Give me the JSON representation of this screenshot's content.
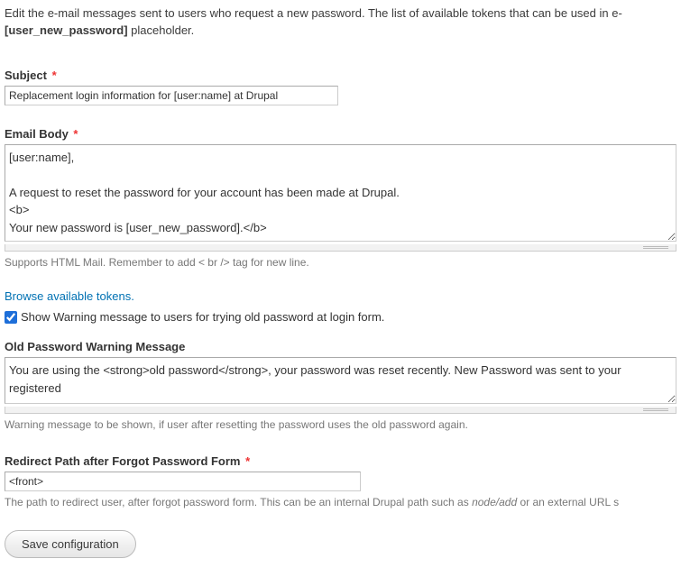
{
  "intro": {
    "line1": "Edit the e-mail messages sent to users who request a new password. The list of available tokens that can be used in e-",
    "bold_token": "[user_new_password]",
    "after_bold": " placeholder."
  },
  "subject": {
    "label": "Subject",
    "value": "Replacement login information for [user:name] at Drupal"
  },
  "email_body": {
    "label": "Email Body",
    "value": "[user:name],\n\nA request to reset the password for your account has been made at Drupal.\n<b>\nYour new password is [user_new_password].</b>",
    "description": "Supports HTML Mail. Remember to add < br /> tag for new line."
  },
  "tokens_link": "Browse available tokens.",
  "show_warning": {
    "checked": true,
    "label": "Show Warning message to users for trying old password at login form."
  },
  "old_pw_warning": {
    "label": "Old Password Warning Message",
    "value": "You are using the <strong>old password</strong>, your password was reset recently. New Password was sent to your registered",
    "description": "Warning message to be shown, if user after resetting the password uses the old password again."
  },
  "redirect": {
    "label": "Redirect Path after Forgot Password Form",
    "value": "<front>",
    "description_before": "The path to redirect user, after forgot password form. This can be an internal Drupal path such as ",
    "description_em": "node/add",
    "description_after": " or an external URL s"
  },
  "submit": {
    "label": "Save configuration"
  }
}
